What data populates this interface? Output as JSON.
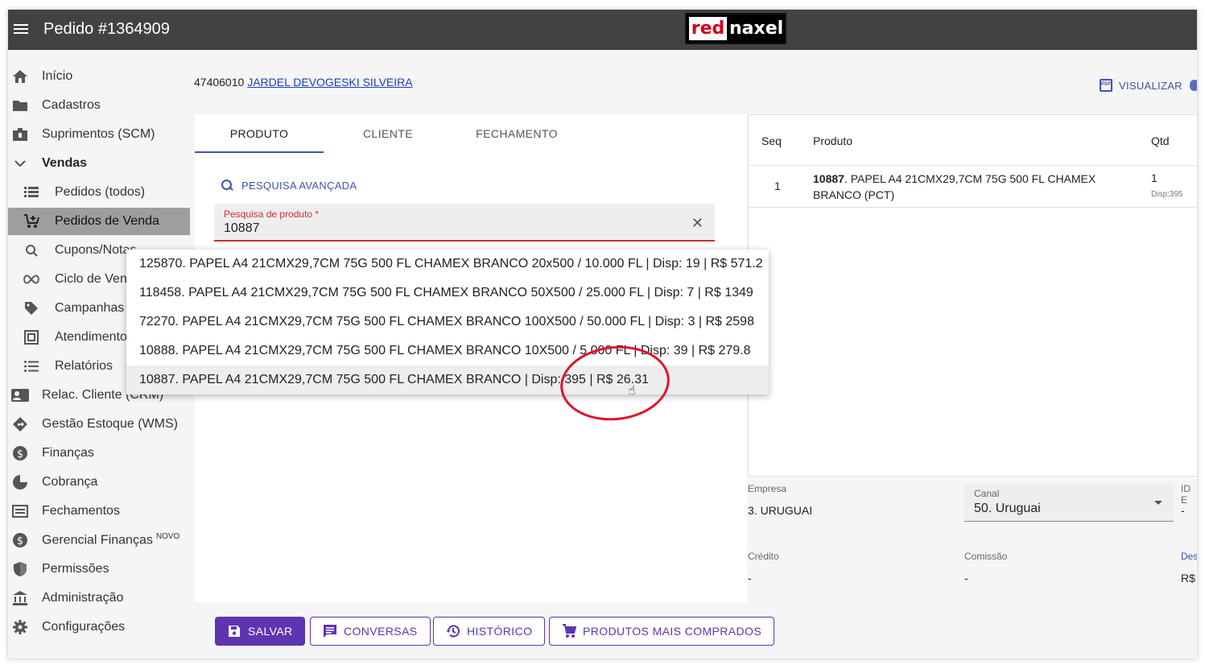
{
  "header": {
    "title": "Pedido #1364909",
    "logo_left": "red",
    "logo_right": "naxel"
  },
  "sidebar": {
    "items": [
      {
        "label": "Início"
      },
      {
        "label": "Cadastros"
      },
      {
        "label": "Suprimentos (SCM)"
      },
      {
        "label": "Vendas"
      },
      {
        "label": "Pedidos (todos)"
      },
      {
        "label": "Pedidos de Venda"
      },
      {
        "label": "Cupons/Notas"
      },
      {
        "label": "Ciclo de Vendas"
      },
      {
        "label": "Campanhas"
      },
      {
        "label": "Atendimento"
      },
      {
        "label": "Relatórios"
      },
      {
        "label": "Relac. Cliente (CRM)"
      },
      {
        "label": "Gestão Estoque (WMS)"
      },
      {
        "label": "Finanças"
      },
      {
        "label": "Cobrança"
      },
      {
        "label": "Fechamentos"
      },
      {
        "label": "Gerencial Finanças",
        "badge": "NOVO"
      },
      {
        "label": "Permissões"
      },
      {
        "label": "Administração"
      },
      {
        "label": "Configurações"
      }
    ]
  },
  "client": {
    "code": "47406010",
    "name": "JARDEL DEVOGESKI SILVEIRA"
  },
  "visualizar": {
    "label": "VISUALIZAR",
    "icon_text": "PDF"
  },
  "tabs": [
    {
      "label": "PRODUTO"
    },
    {
      "label": "CLIENTE"
    },
    {
      "label": "FECHAMENTO"
    }
  ],
  "search": {
    "advanced_label": "PESQUISA AVANÇADA",
    "field_label": "Pesquisa de produto *",
    "value": "10887",
    "results": [
      "125870. PAPEL A4 21CMX29,7CM 75G 500 FL CHAMEX BRANCO 20x500 / 10.000 FL | Disp: 19 | R$ 571.2",
      "118458. PAPEL A4 21CMX29,7CM 75G 500 FL CHAMEX BRANCO 50X500 / 25.000 FL | Disp: 7 | R$ 1349",
      "72270. PAPEL A4 21CMX29,7CM 75G 500 FL CHAMEX BRANCO 100X500 / 50.000 FL | Disp: 3 | R$ 2598",
      "10888. PAPEL A4 21CMX29,7CM 75G 500 FL CHAMEX BRANCO 10X500 / 5.000 FL | Disp: 39 | R$ 279.8",
      "10887. PAPEL A4 21CMX29,7CM 75G 500 FL CHAMEX BRANCO | Disp: 395 | R$ 26.31"
    ]
  },
  "items_table": {
    "headers": {
      "seq": "Seq",
      "produto": "Produto",
      "qtd": "Qtd"
    },
    "rows": [
      {
        "seq": "1",
        "code": "10887",
        "desc": ". PAPEL A4 21CMX29,7CM 75G 500 FL CHAMEX",
        "desc2": "BRANCO (PCT)",
        "qtd": "1",
        "disp": "Disp:395"
      }
    ]
  },
  "fields": {
    "empresa_label": "Empresa",
    "empresa_value": "3. URUGUAI",
    "canal_label": "Canal",
    "canal_value": "50. Uruguai",
    "id_label": "ID E",
    "id_value": "-",
    "credito_label": "Crédito",
    "credito_value": "-",
    "comissao_label": "Comissão",
    "comissao_value": "-",
    "desc_label": "Desc",
    "desc_value": "R$"
  },
  "buttons": {
    "salvar": "SALVAR",
    "conversas": "CONVERSAS",
    "historico": "HISTÓRICO",
    "produtos": "PRODUTOS MAIS COMPRADOS"
  },
  "colors": {
    "accent": "#5e35b1",
    "link": "#1a3fc7",
    "error": "#d32f2f",
    "topbar": "#424242",
    "annotation": "#e0142c"
  }
}
